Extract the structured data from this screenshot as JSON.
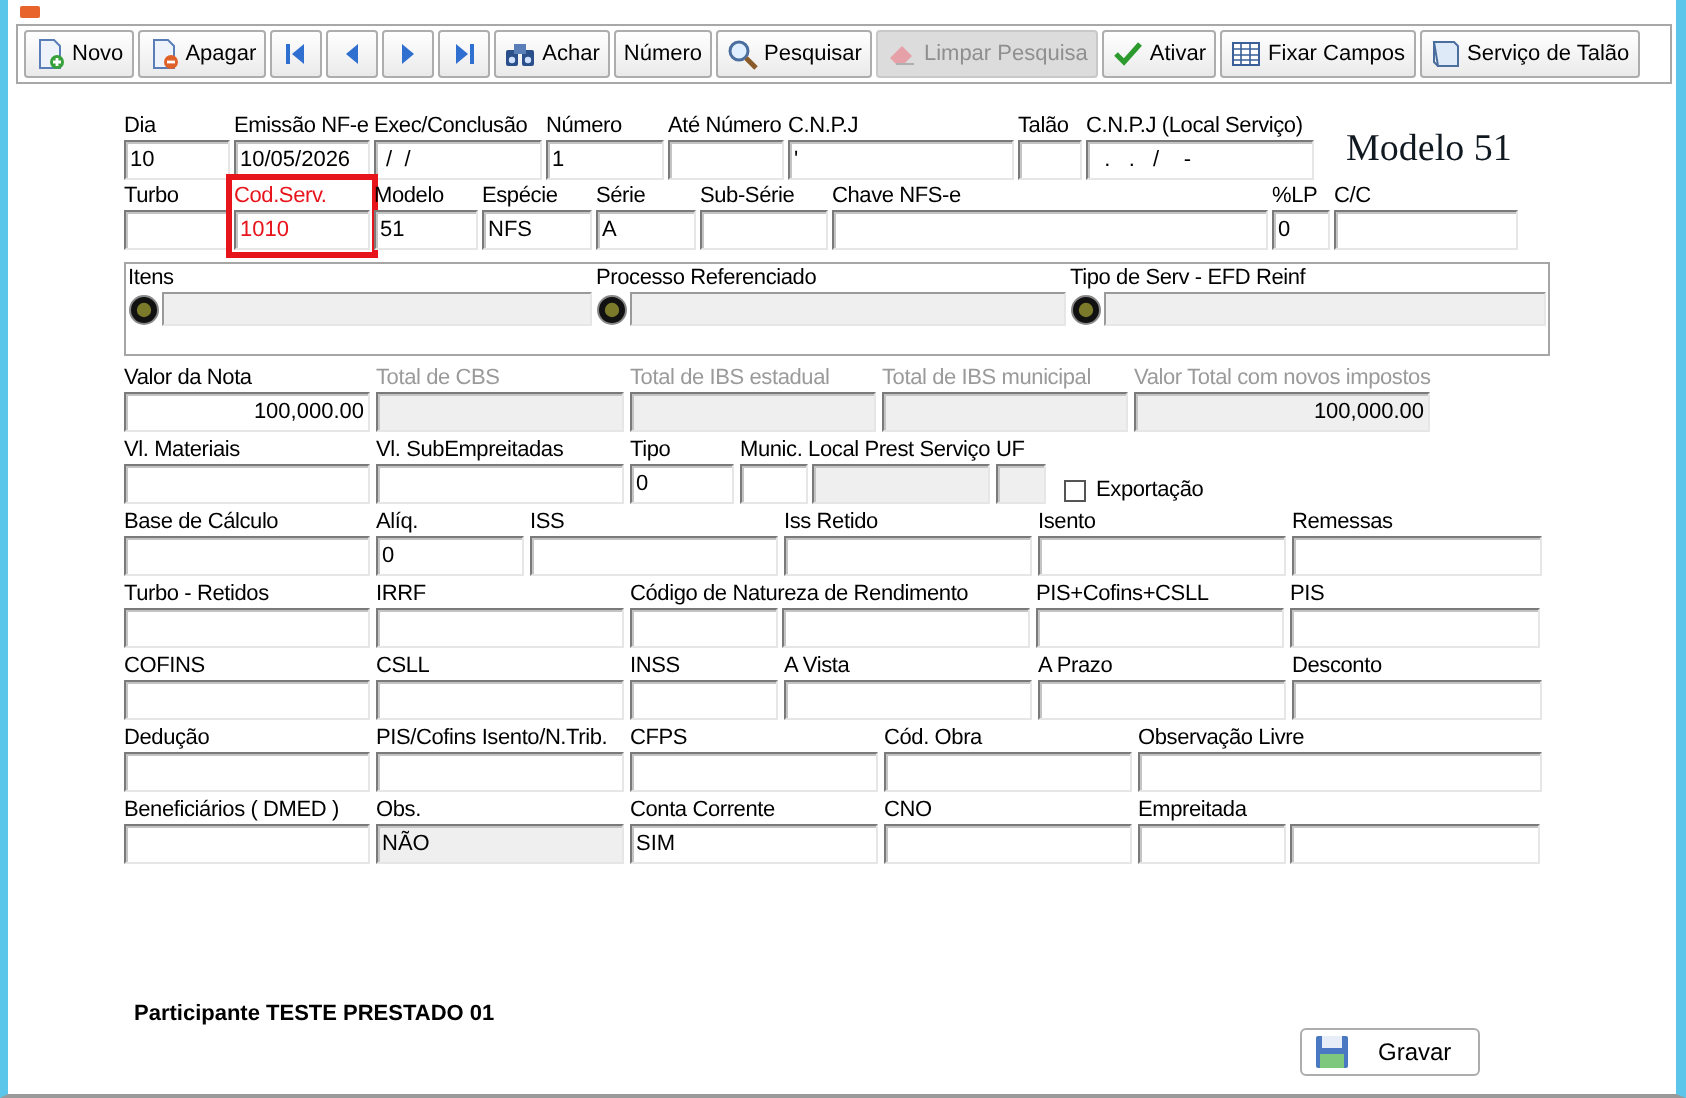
{
  "toolbar": [
    {
      "label": "Novo",
      "kind": "new",
      "disabled": false
    },
    {
      "label": "Apagar",
      "kind": "delete",
      "disabled": false
    },
    {
      "kind": "first",
      "disabled": false
    },
    {
      "kind": "prev",
      "disabled": false
    },
    {
      "kind": "next",
      "disabled": false
    },
    {
      "kind": "last",
      "disabled": false
    },
    {
      "label": "Achar",
      "kind": "find",
      "disabled": false
    },
    {
      "label": "Número",
      "kind": "plain",
      "disabled": false
    },
    {
      "label": "Pesquisar",
      "kind": "search",
      "disabled": false
    },
    {
      "label": "Limpar Pesquisa",
      "kind": "clear",
      "disabled": true
    },
    {
      "label": "Ativar",
      "kind": "check",
      "disabled": false
    },
    {
      "label": "Fixar Campos",
      "kind": "grid",
      "disabled": false
    },
    {
      "label": "Serviço de Talão",
      "kind": "window",
      "disabled": false
    }
  ],
  "model_label": "Modelo 51",
  "header_rows": [
    [
      {
        "kind": "input",
        "label": "Dia",
        "disabled": false,
        "highlighted": false,
        "boxes": [
          {
            "value": "10",
            "readonly": false
          }
        ]
      },
      {
        "kind": "input",
        "label": "Emissão NF-e",
        "disabled": false,
        "highlighted": false,
        "boxes": [
          {
            "value": "10/05/2026",
            "readonly": false
          }
        ]
      },
      {
        "kind": "input",
        "label": "Exec/Conclusão",
        "disabled": false,
        "highlighted": false,
        "boxes": [
          {
            "value": " /  /",
            "readonly": false
          }
        ]
      },
      {
        "kind": "input",
        "label": "Número",
        "disabled": false,
        "highlighted": false,
        "boxes": [
          {
            "value": "1",
            "readonly": false
          }
        ]
      },
      {
        "kind": "input",
        "label": "Até Número",
        "disabled": false,
        "highlighted": false,
        "boxes": [
          {
            "readonly": false
          }
        ]
      },
      {
        "kind": "input",
        "label": "C.N.P.J",
        "disabled": false,
        "highlighted": false,
        "boxes": [
          {
            "value": "'",
            "readonly": false
          }
        ]
      },
      {
        "kind": "input",
        "label": "Talão",
        "disabled": false,
        "highlighted": false,
        "boxes": [
          {
            "readonly": false
          }
        ]
      },
      {
        "kind": "input",
        "label": "C.N.P.J (Local Serviço)",
        "disabled": false,
        "highlighted": false,
        "boxes": [
          {
            "value": "  .   .   /    -",
            "readonly": false
          }
        ]
      }
    ],
    [
      {
        "kind": "input",
        "label": "Turbo",
        "disabled": false,
        "highlighted": false,
        "boxes": [
          {
            "readonly": false
          }
        ]
      },
      {
        "kind": "input",
        "label": "Cod.Serv.",
        "disabled": false,
        "highlighted": true,
        "boxes": [
          {
            "value": "1010",
            "readonly": false
          }
        ]
      },
      {
        "kind": "input",
        "label": "Modelo",
        "disabled": false,
        "highlighted": false,
        "boxes": [
          {
            "value": "51",
            "readonly": false
          }
        ]
      },
      {
        "kind": "input",
        "label": "Espécie",
        "disabled": false,
        "highlighted": false,
        "boxes": [
          {
            "value": "NFS",
            "readonly": false
          }
        ]
      },
      {
        "kind": "input",
        "label": "Série",
        "disabled": false,
        "highlighted": false,
        "boxes": [
          {
            "value": "A",
            "readonly": false
          }
        ]
      },
      {
        "kind": "input",
        "label": "Sub-Série",
        "disabled": false,
        "highlighted": false,
        "boxes": [
          {
            "readonly": false
          }
        ]
      },
      {
        "kind": "input",
        "label": "Chave NFS-e",
        "disabled": false,
        "highlighted": false,
        "boxes": [
          {
            "readonly": false
          }
        ]
      },
      {
        "kind": "input",
        "label": "%LP",
        "disabled": false,
        "highlighted": false,
        "boxes": [
          {
            "value": "0",
            "readonly": false
          }
        ]
      },
      {
        "kind": "input",
        "label": "C/C",
        "disabled": false,
        "highlighted": false,
        "boxes": [
          {
            "readonly": false
          }
        ]
      }
    ]
  ],
  "group": [
    {
      "label": "Itens"
    },
    {
      "label": "Processo Referenciado"
    },
    {
      "label": "Tipo de Serv - EFD Reinf"
    }
  ],
  "value_rows": [
    [
      {
        "kind": "input",
        "label": "Valor da Nota",
        "disabled": false,
        "highlighted": false,
        "boxes": [
          {
            "value": "100,000.00",
            "readonly": false
          }
        ]
      },
      {
        "kind": "input",
        "label": "Total de CBS",
        "disabled": true,
        "highlighted": false,
        "boxes": [
          {
            "readonly": true
          }
        ]
      },
      {
        "kind": "input",
        "label": "Total de IBS estadual",
        "disabled": true,
        "highlighted": false,
        "boxes": [
          {
            "readonly": true
          }
        ]
      },
      {
        "kind": "input",
        "label": "Total de IBS municipal",
        "disabled": true,
        "highlighted": false,
        "boxes": [
          {
            "readonly": true
          }
        ]
      },
      {
        "kind": "input",
        "label": "Valor Total com novos impostos",
        "disabled": true,
        "highlighted": false,
        "boxes": [
          {
            "value": "100,000.00",
            "readonly": true
          }
        ]
      }
    ],
    [
      {
        "kind": "input",
        "label": "Vl. Materiais",
        "disabled": false,
        "highlighted": false,
        "boxes": [
          {
            "readonly": false
          }
        ]
      },
      {
        "kind": "input",
        "label": "Vl. SubEmpreitadas",
        "disabled": false,
        "highlighted": false,
        "boxes": [
          {
            "readonly": false
          }
        ]
      },
      {
        "kind": "input",
        "label": "Tipo",
        "disabled": false,
        "highlighted": false,
        "boxes": [
          {
            "value": "0",
            "readonly": false
          }
        ]
      },
      {
        "kind": "input",
        "label": "Munic. Local Prest Serviço",
        "disabled": false,
        "highlighted": false,
        "boxes": [
          {
            "readonly": false
          },
          {
            "readonly": true
          }
        ]
      },
      {
        "kind": "input",
        "label": "UF",
        "disabled": false,
        "highlighted": false,
        "boxes": [
          {
            "readonly": true
          }
        ]
      },
      {
        "kind": "checkbox",
        "label": "Exportação",
        "checked": false
      }
    ],
    [
      {
        "kind": "input",
        "label": "Base de Cálculo",
        "disabled": false,
        "highlighted": false,
        "boxes": [
          {
            "readonly": false
          }
        ]
      },
      {
        "kind": "input",
        "label": "Alíq.",
        "disabled": false,
        "highlighted": false,
        "boxes": [
          {
            "value": "0",
            "readonly": false
          }
        ]
      },
      {
        "kind": "input",
        "label": "ISS",
        "disabled": false,
        "highlighted": false,
        "boxes": [
          {
            "readonly": false
          }
        ]
      },
      {
        "kind": "input",
        "label": "Iss Retido",
        "disabled": false,
        "highlighted": false,
        "boxes": [
          {
            "readonly": false
          }
        ]
      },
      {
        "kind": "input",
        "label": "Isento",
        "disabled": false,
        "highlighted": false,
        "boxes": [
          {
            "readonly": false
          }
        ]
      },
      {
        "kind": "input",
        "label": "Remessas",
        "disabled": false,
        "highlighted": false,
        "boxes": [
          {
            "readonly": false
          }
        ]
      }
    ],
    [
      {
        "kind": "input",
        "label": "Turbo - Retidos",
        "disabled": false,
        "highlighted": false,
        "boxes": [
          {
            "readonly": false
          }
        ]
      },
      {
        "kind": "input",
        "label": "IRRF",
        "disabled": false,
        "highlighted": false,
        "boxes": [
          {
            "readonly": false
          }
        ]
      },
      {
        "kind": "input",
        "label": "Código de Natureza de Rendimento",
        "disabled": false,
        "highlighted": false,
        "boxes": [
          {
            "readonly": false
          },
          {
            "readonly": false
          }
        ]
      },
      {
        "kind": "input",
        "label": "PIS+Cofins+CSLL",
        "disabled": false,
        "highlighted": false,
        "boxes": [
          {
            "readonly": false
          }
        ]
      },
      {
        "kind": "input",
        "label": "PIS",
        "disabled": false,
        "highlighted": false,
        "boxes": [
          {
            "readonly": false
          }
        ]
      }
    ],
    [
      {
        "kind": "input",
        "label": "COFINS",
        "disabled": false,
        "highlighted": false,
        "boxes": [
          {
            "readonly": false
          }
        ]
      },
      {
        "kind": "input",
        "label": "CSLL",
        "disabled": false,
        "highlighted": false,
        "boxes": [
          {
            "readonly": false
          }
        ]
      },
      {
        "kind": "input",
        "label": "INSS",
        "disabled": false,
        "highlighted": false,
        "boxes": [
          {
            "readonly": false
          }
        ]
      },
      {
        "kind": "input",
        "label": "A Vista",
        "disabled": false,
        "highlighted": false,
        "boxes": [
          {
            "readonly": false
          }
        ]
      },
      {
        "kind": "input",
        "label": "A Prazo",
        "disabled": false,
        "highlighted": false,
        "boxes": [
          {
            "readonly": false
          }
        ]
      },
      {
        "kind": "input",
        "label": "Desconto",
        "disabled": false,
        "highlighted": false,
        "boxes": [
          {
            "readonly": false
          }
        ]
      }
    ],
    [
      {
        "kind": "input",
        "label": "Dedução",
        "disabled": false,
        "highlighted": false,
        "boxes": [
          {
            "readonly": false
          }
        ]
      },
      {
        "kind": "input",
        "label": "PIS/Cofins Isento/N.Trib.",
        "disabled": false,
        "highlighted": false,
        "boxes": [
          {
            "readonly": false
          }
        ]
      },
      {
        "kind": "input",
        "label": "CFPS",
        "disabled": false,
        "highlighted": false,
        "boxes": [
          {
            "readonly": false
          }
        ]
      },
      {
        "kind": "input",
        "label": "Cód. Obra",
        "disabled": false,
        "highlighted": false,
        "boxes": [
          {
            "readonly": false
          }
        ]
      },
      {
        "kind": "input",
        "label": "Observação Livre",
        "disabled": false,
        "highlighted": false,
        "boxes": [
          {
            "readonly": false
          }
        ]
      }
    ],
    [
      {
        "kind": "input",
        "label": "Beneficiários ( DMED )",
        "disabled": false,
        "highlighted": false,
        "boxes": [
          {
            "readonly": false
          }
        ]
      },
      {
        "kind": "input",
        "label": "Obs.",
        "disabled": false,
        "highlighted": false,
        "boxes": [
          {
            "value": "NÃO",
            "readonly": true
          }
        ]
      },
      {
        "kind": "input",
        "label": "Conta Corrente",
        "disabled": false,
        "highlighted": false,
        "boxes": [
          {
            "value": "SIM",
            "readonly": false
          }
        ]
      },
      {
        "kind": "input",
        "label": "CNO",
        "disabled": false,
        "highlighted": false,
        "boxes": [
          {
            "readonly": false
          }
        ]
      },
      {
        "kind": "input",
        "label": "Empreitada",
        "disabled": false,
        "highlighted": false,
        "boxes": [
          {
            "readonly": false
          },
          {
            "readonly": false
          }
        ]
      }
    ]
  ],
  "participant": "Participante TESTE PRESTADO 01",
  "save_button": "Gravar"
}
